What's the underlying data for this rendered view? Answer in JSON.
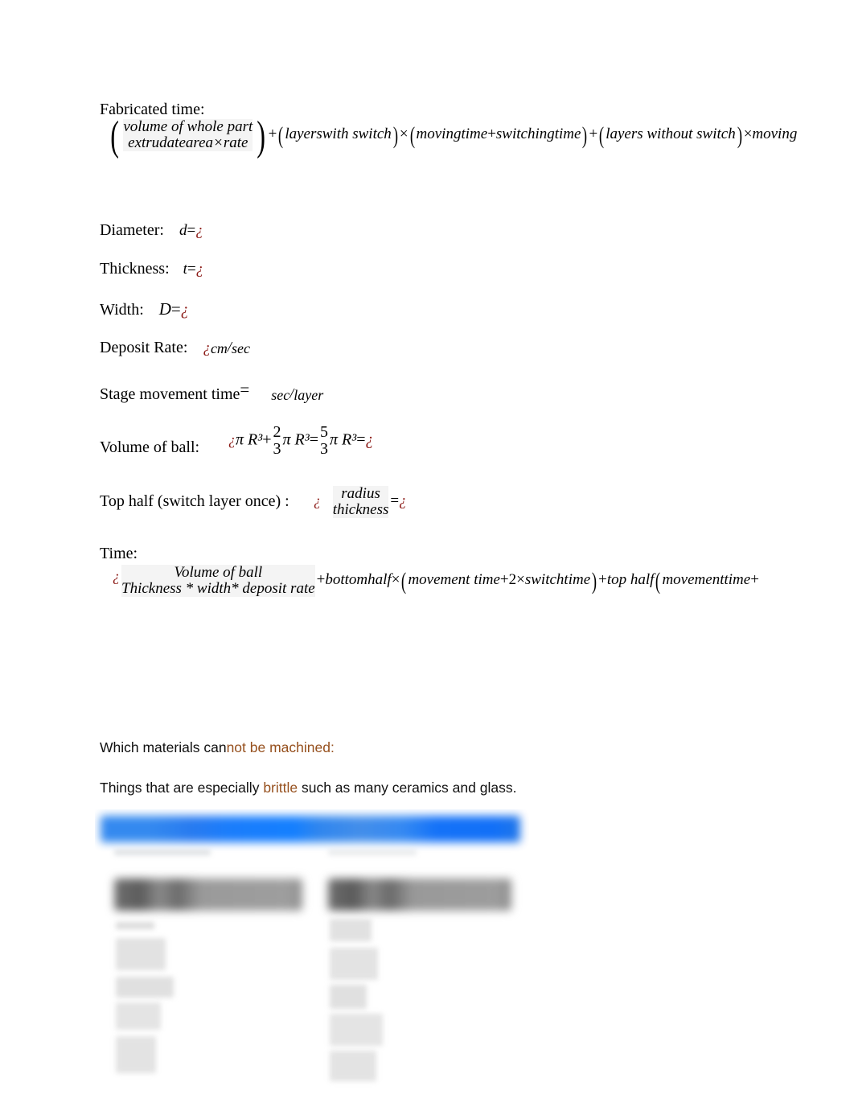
{
  "document": {
    "background_color": "#ffffff",
    "accent_color": "#96501e",
    "math_placeholder_color": "#8c1b17",
    "placeholder_glyph": "¿"
  },
  "sections": {
    "fabricated_time": {
      "label": "Fabricated time:",
      "formula": {
        "fraction": {
          "numerator": "volume of whole part",
          "denominator": "extrudatearea×rate"
        },
        "plus_1": "+",
        "group_1": "layerswith switch",
        "times_1": "×",
        "group_2_left": "movingtime",
        "group_2_plus": "+",
        "group_2_right": "switchingtime",
        "plus_2": "+",
        "group_3": "layers without switch",
        "times_2": "×",
        "trailing_clipped": "moving"
      }
    },
    "diameter": {
      "label": "Diameter:",
      "symbol": "d",
      "equals": "=",
      "value": "¿"
    },
    "thickness": {
      "label": "Thickness:",
      "symbol": "t",
      "equals": "=",
      "value": "¿"
    },
    "width": {
      "label": "Width:",
      "symbol": "D",
      "equals": "=",
      "value": "¿"
    },
    "deposit_rate": {
      "label": "Deposit Rate:",
      "value": "¿",
      "unit_numerator": "cm",
      "unit_slash": "/",
      "unit_denominator": "sec"
    },
    "stage_movement_time": {
      "label": "Stage movement time",
      "equals": "=",
      "unit_numerator": "sec",
      "unit_slash": "/",
      "unit_denominator": "layer"
    },
    "volume_of_ball": {
      "label": "Volume of ball:",
      "lead_placeholder": "¿",
      "term1": "π R³",
      "plus": "+",
      "frac1_num": "2",
      "frac1_den": "3",
      "term2": "π R³",
      "equals1": "=",
      "frac2_num": "5",
      "frac2_den": "3",
      "term3": "π R³",
      "equals2": "=",
      "result": "¿"
    },
    "top_half": {
      "label": "Top half (switch layer once) :",
      "lead_placeholder": "¿",
      "fraction_numerator": "radius",
      "fraction_denominator": "thickness",
      "equals": "=",
      "result": "¿"
    },
    "time": {
      "label": "Time:",
      "lead_placeholder": "¿",
      "fraction_numerator": "Volume of ball",
      "fraction_denominator": "Thickness * width* deposit rate",
      "plus_1": "+",
      "term_bottom_half": "bottomhalf",
      "times_1": "×",
      "group_1_a": "movement time",
      "group_1_plus": "+",
      "group_1_b": "2",
      "group_1_times": "×",
      "group_1_c": "switchtime",
      "plus_2": "+",
      "term_top_half": "top half",
      "group_2_a": "movementtime",
      "group_2_plus": "+"
    }
  },
  "prose": {
    "question_black": "Which materials can",
    "question_accent": "not be machined:",
    "answer_pre": "Things that are especially ",
    "answer_accent": "brittle",
    "answer_post": " such as many ceramics and glass."
  },
  "embedded_screenshot": {
    "description": "blurred screenshot of a two-column web page",
    "header_bar_color": "#0d7bff"
  }
}
